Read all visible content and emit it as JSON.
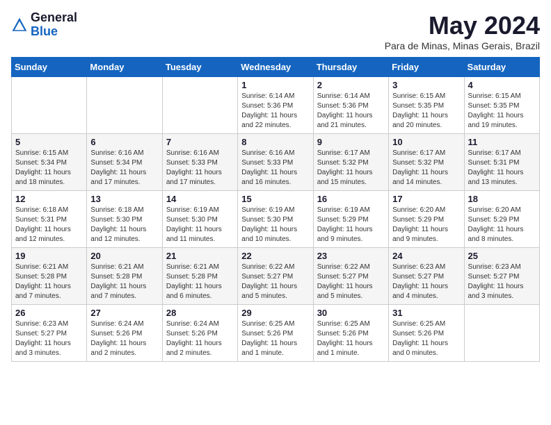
{
  "logo": {
    "general": "General",
    "blue": "Blue"
  },
  "title": "May 2024",
  "location": "Para de Minas, Minas Gerais, Brazil",
  "weekdays": [
    "Sunday",
    "Monday",
    "Tuesday",
    "Wednesday",
    "Thursday",
    "Friday",
    "Saturday"
  ],
  "weeks": [
    [
      {
        "day": "",
        "info": ""
      },
      {
        "day": "",
        "info": ""
      },
      {
        "day": "",
        "info": ""
      },
      {
        "day": "1",
        "info": "Sunrise: 6:14 AM\nSunset: 5:36 PM\nDaylight: 11 hours\nand 22 minutes."
      },
      {
        "day": "2",
        "info": "Sunrise: 6:14 AM\nSunset: 5:36 PM\nDaylight: 11 hours\nand 21 minutes."
      },
      {
        "day": "3",
        "info": "Sunrise: 6:15 AM\nSunset: 5:35 PM\nDaylight: 11 hours\nand 20 minutes."
      },
      {
        "day": "4",
        "info": "Sunrise: 6:15 AM\nSunset: 5:35 PM\nDaylight: 11 hours\nand 19 minutes."
      }
    ],
    [
      {
        "day": "5",
        "info": "Sunrise: 6:15 AM\nSunset: 5:34 PM\nDaylight: 11 hours\nand 18 minutes."
      },
      {
        "day": "6",
        "info": "Sunrise: 6:16 AM\nSunset: 5:34 PM\nDaylight: 11 hours\nand 17 minutes."
      },
      {
        "day": "7",
        "info": "Sunrise: 6:16 AM\nSunset: 5:33 PM\nDaylight: 11 hours\nand 17 minutes."
      },
      {
        "day": "8",
        "info": "Sunrise: 6:16 AM\nSunset: 5:33 PM\nDaylight: 11 hours\nand 16 minutes."
      },
      {
        "day": "9",
        "info": "Sunrise: 6:17 AM\nSunset: 5:32 PM\nDaylight: 11 hours\nand 15 minutes."
      },
      {
        "day": "10",
        "info": "Sunrise: 6:17 AM\nSunset: 5:32 PM\nDaylight: 11 hours\nand 14 minutes."
      },
      {
        "day": "11",
        "info": "Sunrise: 6:17 AM\nSunset: 5:31 PM\nDaylight: 11 hours\nand 13 minutes."
      }
    ],
    [
      {
        "day": "12",
        "info": "Sunrise: 6:18 AM\nSunset: 5:31 PM\nDaylight: 11 hours\nand 12 minutes."
      },
      {
        "day": "13",
        "info": "Sunrise: 6:18 AM\nSunset: 5:30 PM\nDaylight: 11 hours\nand 12 minutes."
      },
      {
        "day": "14",
        "info": "Sunrise: 6:19 AM\nSunset: 5:30 PM\nDaylight: 11 hours\nand 11 minutes."
      },
      {
        "day": "15",
        "info": "Sunrise: 6:19 AM\nSunset: 5:30 PM\nDaylight: 11 hours\nand 10 minutes."
      },
      {
        "day": "16",
        "info": "Sunrise: 6:19 AM\nSunset: 5:29 PM\nDaylight: 11 hours\nand 9 minutes."
      },
      {
        "day": "17",
        "info": "Sunrise: 6:20 AM\nSunset: 5:29 PM\nDaylight: 11 hours\nand 9 minutes."
      },
      {
        "day": "18",
        "info": "Sunrise: 6:20 AM\nSunset: 5:29 PM\nDaylight: 11 hours\nand 8 minutes."
      }
    ],
    [
      {
        "day": "19",
        "info": "Sunrise: 6:21 AM\nSunset: 5:28 PM\nDaylight: 11 hours\nand 7 minutes."
      },
      {
        "day": "20",
        "info": "Sunrise: 6:21 AM\nSunset: 5:28 PM\nDaylight: 11 hours\nand 7 minutes."
      },
      {
        "day": "21",
        "info": "Sunrise: 6:21 AM\nSunset: 5:28 PM\nDaylight: 11 hours\nand 6 minutes."
      },
      {
        "day": "22",
        "info": "Sunrise: 6:22 AM\nSunset: 5:27 PM\nDaylight: 11 hours\nand 5 minutes."
      },
      {
        "day": "23",
        "info": "Sunrise: 6:22 AM\nSunset: 5:27 PM\nDaylight: 11 hours\nand 5 minutes."
      },
      {
        "day": "24",
        "info": "Sunrise: 6:23 AM\nSunset: 5:27 PM\nDaylight: 11 hours\nand 4 minutes."
      },
      {
        "day": "25",
        "info": "Sunrise: 6:23 AM\nSunset: 5:27 PM\nDaylight: 11 hours\nand 3 minutes."
      }
    ],
    [
      {
        "day": "26",
        "info": "Sunrise: 6:23 AM\nSunset: 5:27 PM\nDaylight: 11 hours\nand 3 minutes."
      },
      {
        "day": "27",
        "info": "Sunrise: 6:24 AM\nSunset: 5:26 PM\nDaylight: 11 hours\nand 2 minutes."
      },
      {
        "day": "28",
        "info": "Sunrise: 6:24 AM\nSunset: 5:26 PM\nDaylight: 11 hours\nand 2 minutes."
      },
      {
        "day": "29",
        "info": "Sunrise: 6:25 AM\nSunset: 5:26 PM\nDaylight: 11 hours\nand 1 minute."
      },
      {
        "day": "30",
        "info": "Sunrise: 6:25 AM\nSunset: 5:26 PM\nDaylight: 11 hours\nand 1 minute."
      },
      {
        "day": "31",
        "info": "Sunrise: 6:25 AM\nSunset: 5:26 PM\nDaylight: 11 hours\nand 0 minutes."
      },
      {
        "day": "",
        "info": ""
      }
    ]
  ]
}
